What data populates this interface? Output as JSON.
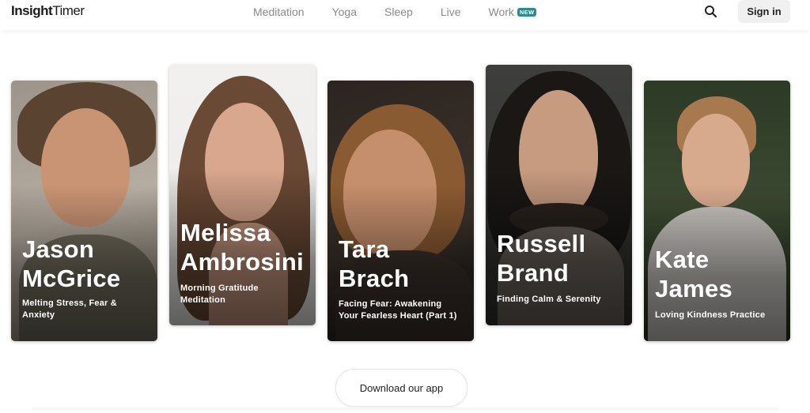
{
  "header": {
    "logo": {
      "part1": "Insight",
      "part2": "Timer"
    },
    "nav": [
      "Meditation",
      "Yoga",
      "Sleep",
      "Live",
      "Work"
    ],
    "work_badge": "NEW",
    "search_icon": "search-icon",
    "signin_label": "Sign in"
  },
  "cards": [
    {
      "name_line1": "Jason",
      "name_line2": "McGrice",
      "title_line1": "Melting Stress, Fear &",
      "title_line2": "Anxiety"
    },
    {
      "name_line1": "Melissa",
      "name_line2": "Ambrosini",
      "title_line1": "Morning Gratitude",
      "title_line2": "Meditation"
    },
    {
      "name_line1": "Tara",
      "name_line2": "Brach",
      "title_line1": "Facing Fear: Awakening",
      "title_line2": "Your Fearless Heart (Part 1)"
    },
    {
      "name_line1": "Russell",
      "name_line2": "Brand",
      "title_line1": "Finding Calm & Serenity",
      "title_line2": ""
    },
    {
      "name_line1": "Kate",
      "name_line2": "James",
      "title_line1": "Loving Kindness Practice",
      "title_line2": ""
    }
  ],
  "download_label": "Download our app",
  "colors": {
    "badge": "#2d8c8a",
    "nav_text": "#8a8a8a",
    "signin_bg": "#f0f0f0"
  }
}
